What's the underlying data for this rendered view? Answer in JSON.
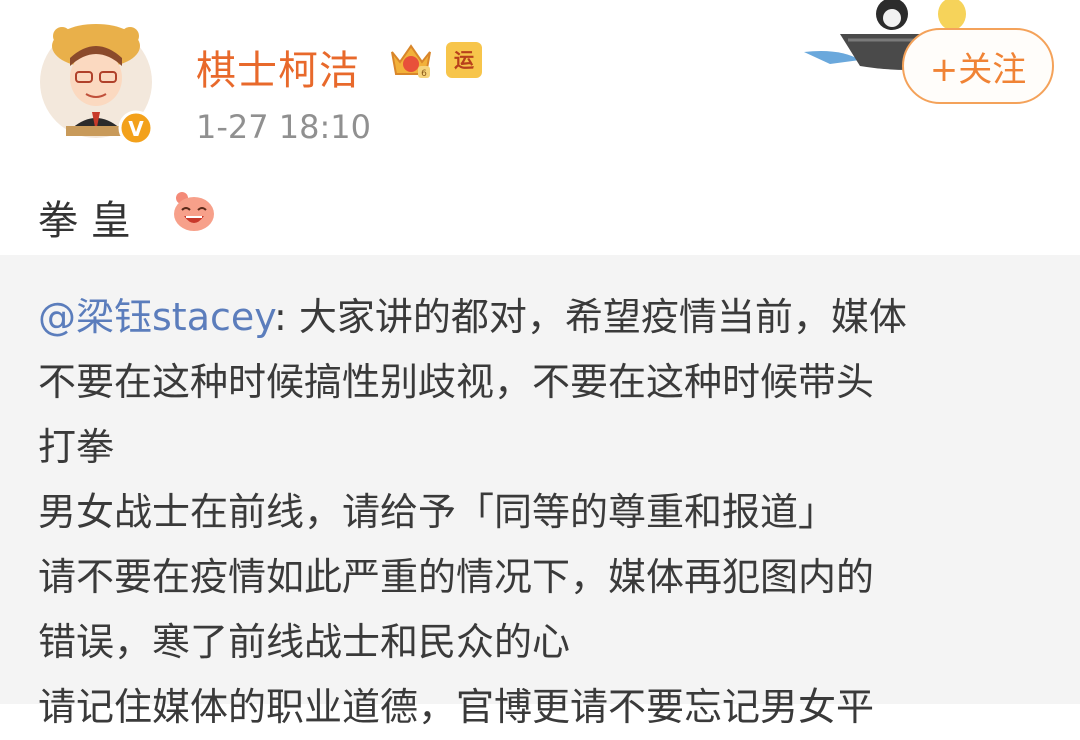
{
  "post": {
    "username": "棋士柯洁",
    "badge_yun": "运",
    "timestamp": "1-27 18:10",
    "follow_label": "+关注",
    "text": "拳  皇"
  },
  "quote": {
    "mention": "@梁钰stacey",
    "first_rest": ": 大家讲的都对，希望疫情当前，媒体",
    "lines": [
      "不要在这种时候搞性别歧视，不要在这种时候带头",
      "打拳",
      "男女战士在前线，请给予「同等的尊重和报道」",
      "请不要在疫情如此严重的情况下，媒体再犯图内的",
      "错误，寒了前线战士和民众的心",
      "请记住媒体的职业道德，官博更请不要忘记男女平"
    ]
  },
  "colors": {
    "username": "#e8692b",
    "mention": "#5b7dbc",
    "follow": "#f08335"
  },
  "icons": [
    "avatar-cartoon",
    "crown-badge-icon",
    "yun-badge-icon",
    "laughing-emoji-icon",
    "boat-sticker"
  ]
}
